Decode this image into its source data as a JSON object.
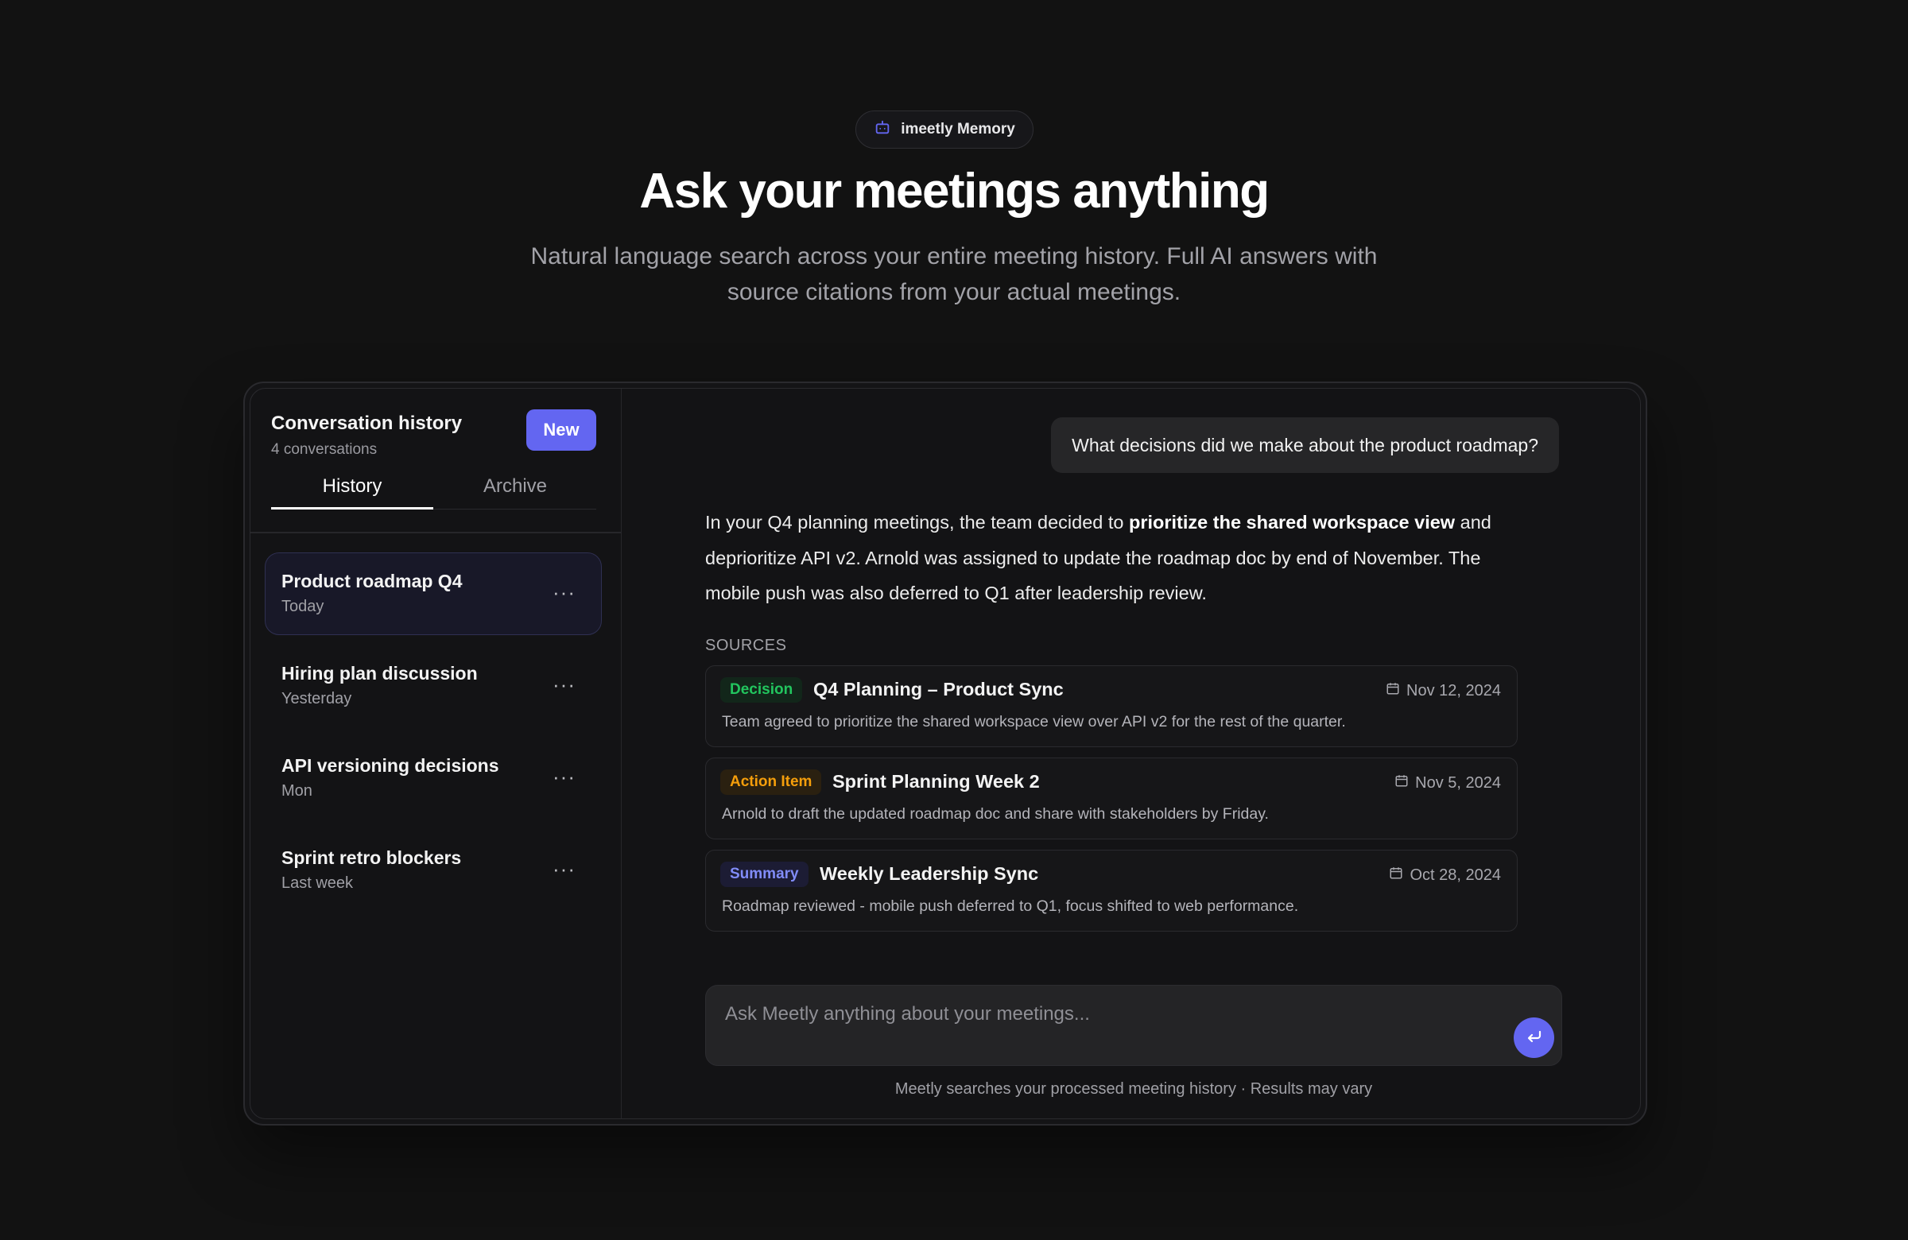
{
  "hero": {
    "badge": "imeetly Memory",
    "title": "Ask your meetings anything",
    "subtitle": "Natural language search across your entire meeting history. Full AI answers with source citations from your actual meetings."
  },
  "sidebar": {
    "title": "Conversation history",
    "count": "4 conversations",
    "new_label": "New",
    "tabs": [
      {
        "label": "History",
        "active": true
      },
      {
        "label": "Archive",
        "active": false
      }
    ],
    "conversations": [
      {
        "title": "Product roadmap Q4",
        "time": "Today",
        "active": true
      },
      {
        "title": "Hiring plan discussion",
        "time": "Yesterday",
        "active": false
      },
      {
        "title": "API versioning decisions",
        "time": "Mon",
        "active": false
      },
      {
        "title": "Sprint retro blockers",
        "time": "Last week",
        "active": false
      }
    ],
    "more_icon": "···"
  },
  "chat": {
    "user_message": "What decisions did we make about the product roadmap?",
    "answer": {
      "part1": "In your Q4 planning meetings, the team decided to ",
      "bold": "prioritize the shared workspace view",
      "part2": " and deprioritize API v2. Arnold was assigned to update the roadmap doc by end of November. The mobile push was also deferred to Q1 after leadership review."
    },
    "sources_label": "SOURCES",
    "sources": [
      {
        "tag": "Decision",
        "tag_color": "#22c55e",
        "tag_bg": "#12261a",
        "title": "Q4 Planning – Product Sync",
        "date": "Nov 12, 2024",
        "desc": "Team agreed to prioritize the shared workspace view over API v2 for the rest of the quarter."
      },
      {
        "tag": "Action Item",
        "tag_color": "#f59e0b",
        "tag_bg": "#2a2010",
        "title": "Sprint Planning Week 2",
        "date": "Nov 5, 2024",
        "desc": "Arnold to draft the updated roadmap doc and share with stakeholders by Friday."
      },
      {
        "tag": "Summary",
        "tag_color": "#818cf8",
        "tag_bg": "#1c1c34",
        "title": "Weekly Leadership Sync",
        "date": "Oct 28, 2024",
        "desc": "Roadmap reviewed - mobile push deferred to Q1, focus shifted to web performance."
      }
    ],
    "input_placeholder": "Ask Meetly anything about your meetings...",
    "disclaimer": "Meetly searches your processed meeting history · Results may vary"
  },
  "colors": {
    "accent": "#6366f1",
    "background": "#121212"
  },
  "icons": {
    "badge": "robot-icon",
    "date": "calendar-icon",
    "send": "enter-arrow-icon",
    "more": "more-dots-icon"
  }
}
